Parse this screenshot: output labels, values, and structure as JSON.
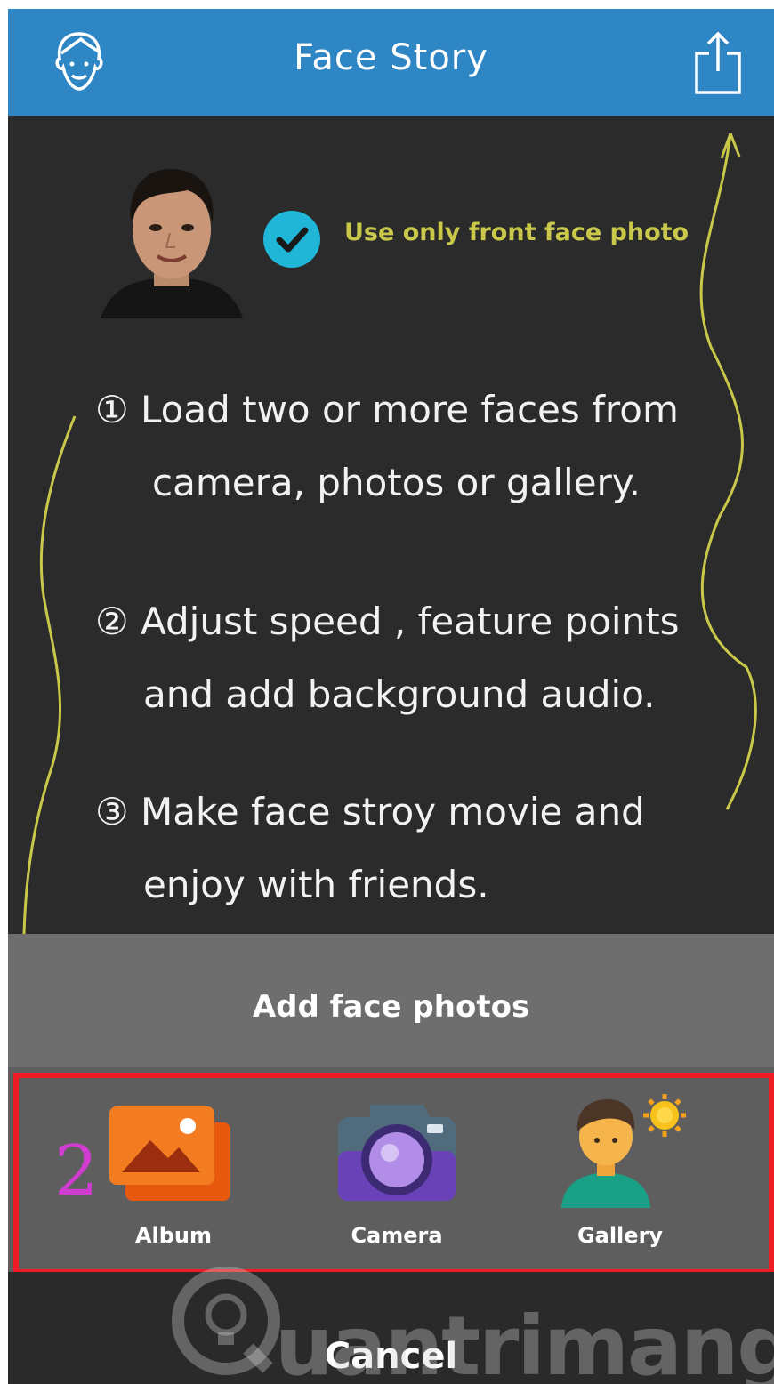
{
  "header": {
    "title": "Face Story"
  },
  "intro": {
    "tip": "Use only front  face photo"
  },
  "steps": [
    {
      "line1": "① Load two or more faces from",
      "line2": "camera, photos or gallery."
    },
    {
      "line1": "② Adjust speed , feature points",
      "line2": "and add background audio."
    },
    {
      "line1": "③ Make face stroy movie and",
      "line2": "enjoy with friends."
    }
  ],
  "sheet": {
    "title": "Add face photos",
    "options": [
      {
        "label": "Album",
        "icon": "album-icon"
      },
      {
        "label": "Camera",
        "icon": "camera-icon"
      },
      {
        "label": "Gallery",
        "icon": "gallery-icon"
      }
    ],
    "cancel_label": "Cancel"
  },
  "annotation": {
    "number": "2"
  },
  "watermark": {
    "text": "uantrimang"
  },
  "colors": {
    "header": "#2f86c4",
    "tip": "#c9c84a",
    "check": "#1fb6d8",
    "highlight": "#ee1c25",
    "annotation": "#d03cd0"
  }
}
